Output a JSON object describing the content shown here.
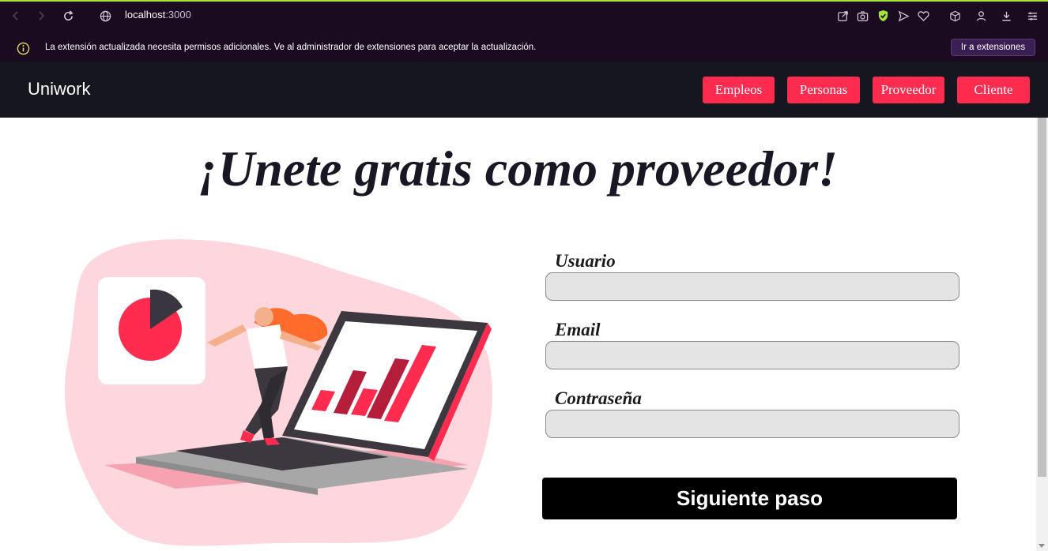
{
  "browser": {
    "url_host": "localhost",
    "url_port": ":3000",
    "notice_text": "La extensión actualizada necesita permisos adicionales. Ve al administrador de extensiones para aceptar la actualización.",
    "ext_button": "Ir a extensiones",
    "icons": [
      "back-icon",
      "forward-icon",
      "reload-icon",
      "globe-icon",
      "share-icon",
      "camera-icon",
      "shield-icon",
      "send-icon",
      "heart-icon",
      "cube-icon",
      "profile-icon",
      "download-icon",
      "menu-icon",
      "info-icon"
    ]
  },
  "nav": {
    "brand": "Uniwork",
    "items": [
      {
        "label": "Empleos"
      },
      {
        "label": "Personas"
      },
      {
        "label": "Proveedor"
      },
      {
        "label": "Cliente"
      }
    ]
  },
  "page": {
    "title": "¡Unete gratis como proveedor!"
  },
  "form": {
    "user_label": "Usuario",
    "user_value": "",
    "email_label": "Email",
    "email_value": "",
    "password_label": "Contraseña",
    "password_value": "",
    "submit": "Siguiente paso"
  },
  "colors": {
    "accent": "#ff2c4f",
    "navbar": "#16161f",
    "browser_bg": "#1a0b21"
  }
}
